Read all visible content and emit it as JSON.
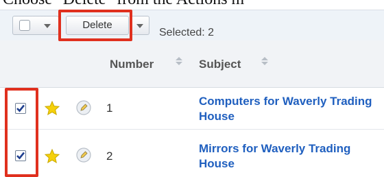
{
  "caption": "Choose \"Delete\" from the Actions m",
  "toolbar": {
    "delete_label": "Delete",
    "selected_text": "Selected: 2"
  },
  "table": {
    "columns": [
      "Number",
      "Subject"
    ],
    "rows": [
      {
        "number": "1",
        "subject": "Computers for Waverly Trading House",
        "checked": true
      },
      {
        "number": "2",
        "subject": "Mirrors for Waverly Trading House",
        "checked": true
      }
    ]
  },
  "icons": {
    "favorite": "star-icon",
    "preview": "pencil-icon",
    "sort": "sort-arrows-icon",
    "dropdown": "caret-down-icon"
  },
  "colors": {
    "highlight": "#e0301e",
    "link": "#1f5fbf",
    "star": "#f5d00a",
    "header_bg": "#f1f3f6",
    "toolbar_bg": "#eef3f8"
  }
}
